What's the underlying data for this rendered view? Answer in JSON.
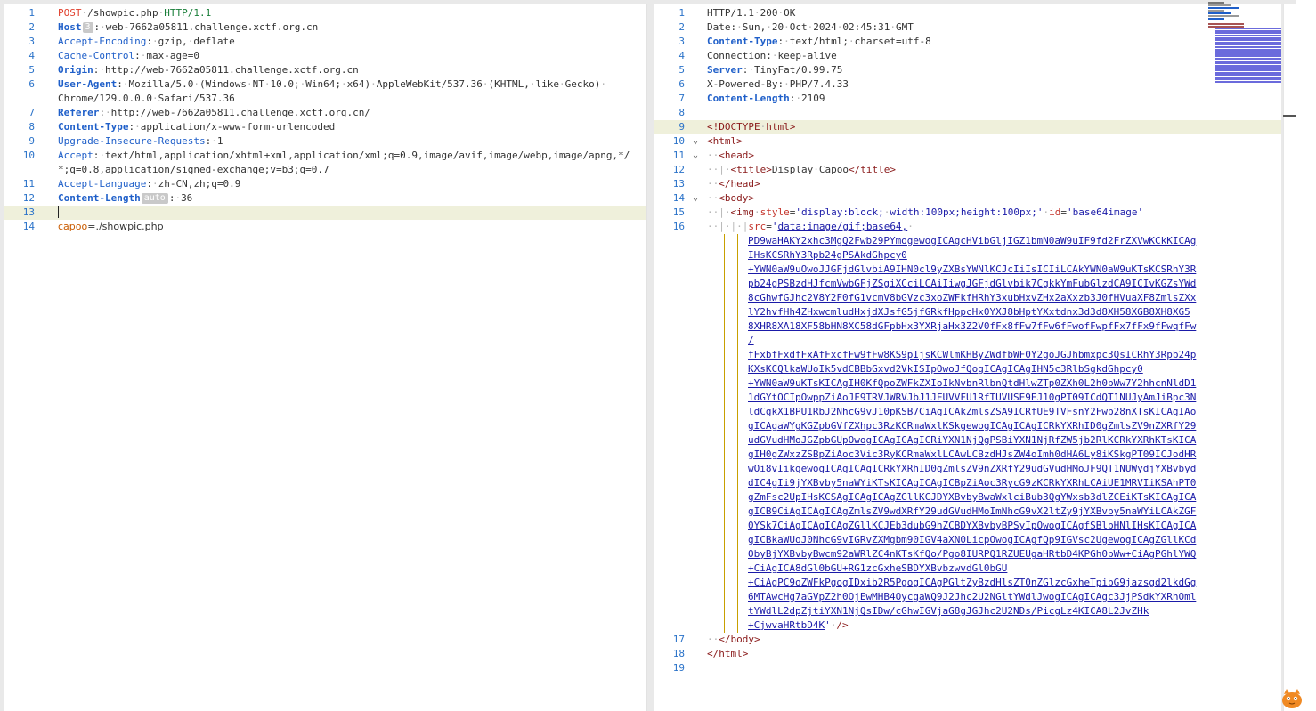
{
  "request": {
    "lines": [
      {
        "n": "1",
        "parts": [
          {
            "c": "method",
            "t": "POST"
          },
          {
            "c": "dot",
            "t": "·"
          },
          {
            "c": "hval",
            "t": "/showpic.php"
          },
          {
            "c": "dot",
            "t": "·"
          },
          {
            "c": "proto",
            "t": "HTTP/1.1"
          }
        ]
      },
      {
        "n": "2",
        "parts": [
          {
            "c": "hname bold",
            "t": "Host"
          },
          {
            "c": "badge",
            "t": "3"
          },
          {
            "c": "hval",
            "t": ":"
          },
          {
            "c": "dot",
            "t": "·"
          },
          {
            "c": "hval",
            "t": "web-7662a05811.challenge.xctf.org.cn"
          }
        ]
      },
      {
        "n": "3",
        "parts": [
          {
            "c": "hname",
            "t": "Accept-Encoding"
          },
          {
            "c": "hval",
            "t": ":"
          },
          {
            "c": "dot",
            "t": "·"
          },
          {
            "c": "hval",
            "t": "gzip,"
          },
          {
            "c": "dot",
            "t": "·"
          },
          {
            "c": "hval",
            "t": "deflate"
          }
        ]
      },
      {
        "n": "4",
        "parts": [
          {
            "c": "hname",
            "t": "Cache-Control"
          },
          {
            "c": "hval",
            "t": ":"
          },
          {
            "c": "dot",
            "t": "·"
          },
          {
            "c": "hval",
            "t": "max-age=0"
          }
        ]
      },
      {
        "n": "5",
        "parts": [
          {
            "c": "hname bold",
            "t": "Origin"
          },
          {
            "c": "hval",
            "t": ":"
          },
          {
            "c": "dot",
            "t": "·"
          },
          {
            "c": "hval",
            "t": "http://web-7662a05811.challenge.xctf.org.cn"
          }
        ]
      },
      {
        "n": "6",
        "parts": [
          {
            "c": "hname bold",
            "t": "User-Agent"
          },
          {
            "c": "hval",
            "t": ":"
          },
          {
            "c": "dot",
            "t": "·"
          },
          {
            "c": "hval",
            "t": "Mozilla/5.0"
          },
          {
            "c": "dot",
            "t": "·"
          },
          {
            "c": "hval",
            "t": "(Windows"
          },
          {
            "c": "dot",
            "t": "·"
          },
          {
            "c": "hval",
            "t": "NT"
          },
          {
            "c": "dot",
            "t": "·"
          },
          {
            "c": "hval",
            "t": "10.0;"
          },
          {
            "c": "dot",
            "t": "·"
          },
          {
            "c": "hval",
            "t": "Win64;"
          },
          {
            "c": "dot",
            "t": "·"
          },
          {
            "c": "hval",
            "t": "x64)"
          },
          {
            "c": "dot",
            "t": "·"
          },
          {
            "c": "hval",
            "t": "AppleWebKit/537.36"
          },
          {
            "c": "dot",
            "t": "·"
          },
          {
            "c": "hval",
            "t": "(KHTML,"
          },
          {
            "c": "dot",
            "t": "·"
          },
          {
            "c": "hval",
            "t": "like"
          },
          {
            "c": "dot",
            "t": "·"
          },
          {
            "c": "hval",
            "t": "Gecko)"
          },
          {
            "c": "dot",
            "t": "·"
          }
        ]
      },
      {
        "n": "",
        "parts": [
          {
            "c": "hval",
            "t": "Chrome/129.0.0.0"
          },
          {
            "c": "dot",
            "t": "·"
          },
          {
            "c": "hval",
            "t": "Safari/537.36"
          }
        ]
      },
      {
        "n": "7",
        "parts": [
          {
            "c": "hname bold",
            "t": "Referer"
          },
          {
            "c": "hval",
            "t": ":"
          },
          {
            "c": "dot",
            "t": "·"
          },
          {
            "c": "hval",
            "t": "http://web-7662a05811.challenge.xctf.org.cn/"
          }
        ]
      },
      {
        "n": "8",
        "parts": [
          {
            "c": "hname bold",
            "t": "Content-Type"
          },
          {
            "c": "hval",
            "t": ":"
          },
          {
            "c": "dot",
            "t": "·"
          },
          {
            "c": "hval",
            "t": "application/x-www-form-urlencoded"
          }
        ]
      },
      {
        "n": "9",
        "parts": [
          {
            "c": "hname",
            "t": "Upgrade-Insecure-Requests"
          },
          {
            "c": "hval",
            "t": ":"
          },
          {
            "c": "dot",
            "t": "·"
          },
          {
            "c": "hval",
            "t": "1"
          }
        ]
      },
      {
        "n": "10",
        "parts": [
          {
            "c": "hname",
            "t": "Accept"
          },
          {
            "c": "hval",
            "t": ":"
          },
          {
            "c": "dot",
            "t": "·"
          },
          {
            "c": "hval",
            "t": "text/html,application/xhtml+xml,application/xml;q=0.9,image/avif,image/webp,image/apng,*/"
          }
        ]
      },
      {
        "n": "",
        "parts": [
          {
            "c": "hval",
            "t": "*;q=0.8,application/signed-exchange;v=b3;q=0.7"
          }
        ]
      },
      {
        "n": "11",
        "parts": [
          {
            "c": "hname",
            "t": "Accept-Language"
          },
          {
            "c": "hval",
            "t": ":"
          },
          {
            "c": "dot",
            "t": "·"
          },
          {
            "c": "hval",
            "t": "zh-CN,zh;q=0.9"
          }
        ]
      },
      {
        "n": "12",
        "parts": [
          {
            "c": "hname bold",
            "t": "Content-Length"
          },
          {
            "c": "badge",
            "t": "auto"
          },
          {
            "c": "hval",
            "t": ":"
          },
          {
            "c": "dot",
            "t": "·"
          },
          {
            "c": "hval",
            "t": "36"
          }
        ]
      },
      {
        "n": "13",
        "hl": true,
        "cursor": true,
        "parts": []
      },
      {
        "n": "14",
        "param": true,
        "parts": [
          {
            "c": "pkey",
            "t": "capoo"
          },
          {
            "c": "pval",
            "t": "=./showpic.php"
          }
        ]
      }
    ]
  },
  "response": {
    "lines": [
      {
        "n": "1",
        "parts": [
          {
            "c": "hval",
            "t": "HTTP/1.1"
          },
          {
            "c": "dot",
            "t": "·"
          },
          {
            "c": "hval",
            "t": "200"
          },
          {
            "c": "dot",
            "t": "·"
          },
          {
            "c": "hval",
            "t": "OK"
          }
        ]
      },
      {
        "n": "2",
        "parts": [
          {
            "c": "hval",
            "t": "Date:"
          },
          {
            "c": "dot",
            "t": "·"
          },
          {
            "c": "hval",
            "t": "Sun,"
          },
          {
            "c": "dot",
            "t": "·"
          },
          {
            "c": "hval",
            "t": "20"
          },
          {
            "c": "dot",
            "t": "·"
          },
          {
            "c": "hval",
            "t": "Oct"
          },
          {
            "c": "dot",
            "t": "·"
          },
          {
            "c": "hval",
            "t": "2024"
          },
          {
            "c": "dot",
            "t": "·"
          },
          {
            "c": "hval",
            "t": "02:45:31"
          },
          {
            "c": "dot",
            "t": "·"
          },
          {
            "c": "hval",
            "t": "GMT"
          }
        ]
      },
      {
        "n": "3",
        "parts": [
          {
            "c": "hname bold",
            "t": "Content-Type"
          },
          {
            "c": "hval",
            "t": ":"
          },
          {
            "c": "dot",
            "t": "·"
          },
          {
            "c": "hval",
            "t": "text/html;"
          },
          {
            "c": "dot",
            "t": "·"
          },
          {
            "c": "hval",
            "t": "charset=utf-8"
          }
        ]
      },
      {
        "n": "4",
        "parts": [
          {
            "c": "hval",
            "t": "Connection:"
          },
          {
            "c": "dot",
            "t": "·"
          },
          {
            "c": "hval",
            "t": "keep-alive"
          }
        ]
      },
      {
        "n": "5",
        "parts": [
          {
            "c": "hname bold",
            "t": "Server"
          },
          {
            "c": "hval",
            "t": ":"
          },
          {
            "c": "dot",
            "t": "·"
          },
          {
            "c": "hval",
            "t": "TinyFat/0.99.75"
          }
        ]
      },
      {
        "n": "6",
        "parts": [
          {
            "c": "hval",
            "t": "X-Powered-By:"
          },
          {
            "c": "dot",
            "t": "·"
          },
          {
            "c": "hval",
            "t": "PHP/7.4.33"
          }
        ]
      },
      {
        "n": "7",
        "parts": [
          {
            "c": "hname bold",
            "t": "Content-Length"
          },
          {
            "c": "hval",
            "t": ":"
          },
          {
            "c": "dot",
            "t": "·"
          },
          {
            "c": "hval",
            "t": "2109"
          }
        ]
      },
      {
        "n": "8",
        "parts": []
      },
      {
        "n": "9",
        "hl": true,
        "parts": [
          {
            "c": "doctype",
            "t": "<!DOCTYPE"
          },
          {
            "c": "dot",
            "t": "·"
          },
          {
            "c": "tagname",
            "t": "html>"
          }
        ]
      },
      {
        "n": "10",
        "fold": true,
        "parts": [
          {
            "c": "tag",
            "t": "<html>"
          }
        ]
      },
      {
        "n": "11",
        "fold": true,
        "parts": [
          {
            "c": "dot",
            "t": "··"
          },
          {
            "c": "tag",
            "t": "<head>"
          }
        ]
      },
      {
        "n": "12",
        "parts": [
          {
            "c": "dot",
            "t": "··|·"
          },
          {
            "c": "tag",
            "t": "<title>"
          },
          {
            "c": "hval",
            "t": "Display"
          },
          {
            "c": "dot",
            "t": "·"
          },
          {
            "c": "hval",
            "t": "Capoo"
          },
          {
            "c": "tag",
            "t": "</title>"
          }
        ]
      },
      {
        "n": "13",
        "parts": [
          {
            "c": "dot",
            "t": "··"
          },
          {
            "c": "tag",
            "t": "</head>"
          }
        ]
      },
      {
        "n": "14",
        "fold": true,
        "parts": [
          {
            "c": "dot",
            "t": "··"
          },
          {
            "c": "tag",
            "t": "<body>"
          }
        ]
      },
      {
        "n": "15",
        "parts": [
          {
            "c": "dot",
            "t": "··|·"
          },
          {
            "c": "tag",
            "t": "<img"
          },
          {
            "c": "dot",
            "t": "·"
          },
          {
            "c": "attr",
            "t": "style"
          },
          {
            "c": "hval",
            "t": "="
          },
          {
            "c": "attrval",
            "t": "'display:block;"
          },
          {
            "c": "dot",
            "t": "·"
          },
          {
            "c": "attrval",
            "t": "width:100px;height:100px;'"
          },
          {
            "c": "dot",
            "t": "·"
          },
          {
            "c": "attr",
            "t": "id"
          },
          {
            "c": "hval",
            "t": "="
          },
          {
            "c": "attrval",
            "t": "'base64image'"
          }
        ]
      },
      {
        "n": "16",
        "parts": [
          {
            "c": "dot",
            "t": "··|·|·|"
          },
          {
            "c": "attr",
            "t": "src"
          },
          {
            "c": "hval",
            "t": "="
          },
          {
            "c": "attrval",
            "t": "'"
          },
          {
            "c": "b64",
            "t": "data:image/gif;base64,"
          },
          {
            "c": "dot",
            "t": "·"
          }
        ]
      }
    ],
    "b64_lines": [
      "PD9waHAKY2xhc3MgQ2Fwb29PYmogewogICAgcHVibGljIGZ1bmN0aW9uIF9fd2FrZXVwKCkKICAg",
      "IHsKCSRhY3Rpb24gPSAkdGhpcy0",
      "+YWN0aW9uOwoJJGFjdGlvbiA9IHN0cl9yZXBsYWNlKCJcIiIsICIiLCAkYWN0aW9uKTsKCSRhY3R",
      "pb24gPSBzdHJfcmVwbGFjZSgiXCciLCAiIiwgJGFjdGlvbik7CgkkYmFubGlzdCA9ICIvKGZsYWd",
      "8cGhwfGJhc2V8Y2F0fG1vcmV8bGVzc3xoZWFkfHRhY3xubHxvZHx2aXxzb3J0fHVuaXF8ZmlsZXx",
      "lY2hvfHh4ZHxwcmludHxjdXJsfG5jfGRkfHppcHx0YXJ8bHptYXxtdnx3d3d8XH58XGB8XH8XG5",
      "8XHR8XA18XF58bHN8XC58dGFpbHx3YXRjaHx3Z2V0fFx8fFw7fFw6fFwofFwpfFx7fFx9fFwqfFw",
      "/",
      "fFxbfFxdfFxAfFxcfFw9fFw8KS9pIjsKCWlmKHByZWdfbWF0Y2goJGJhbmxpc3QsICRhY3Rpb24p",
      "KXsKCQlkaWUoIk5vdCBBbGxvd2VkISIpOwoJfQogICAgICAgIHN5c3RlbSgkdGhpcy0",
      "+YWN0aW9uKTsKICAgIH0KfQpoZWFkZXIoIkNvbnRlbnQtdHlwZTp0ZXh0L2h0bWw7Y2hhcnNldD1",
      "1dGYtOCIpOwppZiAoJF9TRVJWRVJbJ1JFUVVFU1RfTUVUSE9EJ10gPT09ICdQT1NUJyAmJiBpc3N",
      "ldCgkX1BPU1RbJ2NhcG9vJ10pKSB7CiAgICAkZmlsZSA9ICRfUE9TVFsnY2Fwb28nXTsKICAgIAo",
      "gICAgaWYgKGZpbGVfZXhpc3RzKCRmaWxlKSkgewogICAgICAgICRkYXRhID0gZmlsZV9nZXRfY29",
      "udGVudHMoJGZpbGUpOwogICAgICAgICRiYXN1NjQgPSBiYXN1NjRfZW5jb2RlKCRkYXRhKTsKICA",
      "gIH0gZWxzZSBpZiAoc3Vic3RyKCRmaWxlLCAwLCBzdHJsZW4oImh0dHA6Ly8iKSkgPT09ICJodHR",
      "wOi8vIikgewogICAgICAgICRkYXRhID0gZmlsZV9nZXRfY29udGVudHMoJF9QT1NUWydjYXBvbyd",
      "dIC4gIi9jYXBvby5naWYiKTsKICAgICAgICBpZiAoc3RycG9zKCRkYXRhLCAiUE1MRVIiKSAhPT0",
      "gZmFsc2UpIHsKCSAgICAgICAgZGllKCJDYXBvbyBwaWxlciBub3QgYWxsb3dlZCEiKTsKICAgICA",
      "gICB9CiAgICAgICAgZmlsZV9wdXRfY29udGVudHMoImNhcG9vX2ltZy9jYXBvby5naWYiLCAkZGF",
      "0YSk7CiAgICAgICAgZGllKCJEb3dubG9hZCBDYXBvbyBPSyIpOwogICAgfSBlbHNlIHsKICAgICA",
      "gICBkaWUoJ0NhcG9vIGRvZXMgbm90IGV4aXN0LicpOwogICAgfQp9IGVsc2UgewogICAgZGllKCd",
      "ObyBjYXBvbyBwcm92aWRlZC4nKTsKfQo/Pgo8IURPQ1RZUEUgaHRtbD4KPGh0bWw+CiAgPGhlYWQ",
      "+CiAgICA8dGl0bGU+RG1zcGxheSBDYXBvbzwvdGl0bGU",
      "+CiAgPC9oZWFkPgogIDxib2R5PgogICAgPGltZyBzdHlsZT0nZGlzcGxheTpibG9jazsgd2lkdGg",
      "6MTAwcHg7aGVpZ2h0OjEwMHB4OycgaWQ9J2Jhc2U2NGltYWdlJwogICAgICAgc3JjPSdkYXRhOml",
      "tYWdlL2dpZjtiYXN1NjQsIDw/cGhwIGVjaG8gJGJhc2U2NDs/PicgLz4KICA8L2JvZHk",
      "+CjwvaHRtbD4K"
    ],
    "b64_tail": [
      {
        "c": "attrval",
        "t": "'"
      },
      {
        "c": "dot",
        "t": "·"
      },
      {
        "c": "tag",
        "t": "/>"
      }
    ],
    "after": [
      {
        "n": "17",
        "parts": [
          {
            "c": "dot",
            "t": "··"
          },
          {
            "c": "tag",
            "t": "</body>"
          }
        ]
      },
      {
        "n": "18",
        "parts": [
          {
            "c": "tag",
            "t": "</html>"
          }
        ]
      },
      {
        "n": "19",
        "parts": []
      }
    ]
  },
  "colors": {
    "line_number": "#2b73c9",
    "header_name": "#1f5fc9",
    "method": "#e0402e",
    "highlight": "#eff0db"
  }
}
